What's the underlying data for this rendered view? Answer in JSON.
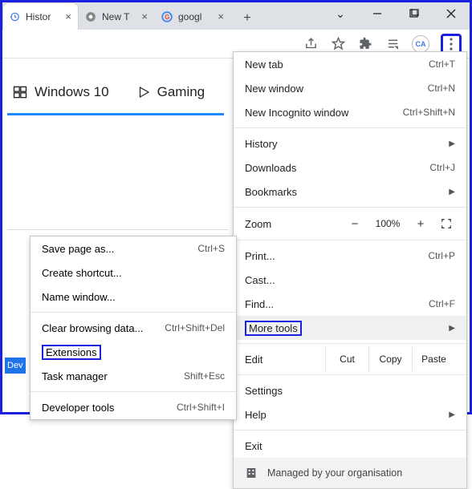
{
  "tabs": [
    {
      "label": "Histor",
      "icon": "history"
    },
    {
      "label": "New T",
      "icon": "chrome"
    },
    {
      "label": "googl",
      "icon": "google"
    }
  ],
  "winControls": {
    "dropdown": "⌄",
    "min": "—",
    "max": "▢",
    "close": "✕"
  },
  "toolbar": {
    "avatar": "CA"
  },
  "page": {
    "pill1": "Windows 10",
    "pill2": "Gaming"
  },
  "menu": {
    "newtab": {
      "label": "New tab",
      "accel": "Ctrl+T"
    },
    "newwin": {
      "label": "New window",
      "accel": "Ctrl+N"
    },
    "incog": {
      "label": "New Incognito window",
      "accel": "Ctrl+Shift+N"
    },
    "history": {
      "label": "History"
    },
    "downloads": {
      "label": "Downloads",
      "accel": "Ctrl+J"
    },
    "bookmarks": {
      "label": "Bookmarks"
    },
    "zoom": {
      "label": "Zoom",
      "value": "100%"
    },
    "print": {
      "label": "Print...",
      "accel": "Ctrl+P"
    },
    "cast": {
      "label": "Cast..."
    },
    "find": {
      "label": "Find...",
      "accel": "Ctrl+F"
    },
    "moretools": {
      "label": "More tools"
    },
    "edit": {
      "label": "Edit",
      "cut": "Cut",
      "copy": "Copy",
      "paste": "Paste"
    },
    "settings": {
      "label": "Settings"
    },
    "help": {
      "label": "Help"
    },
    "exit": {
      "label": "Exit"
    },
    "managed": {
      "label": "Managed by your organisation"
    }
  },
  "submenu": {
    "savepage": {
      "label": "Save page as...",
      "accel": "Ctrl+S"
    },
    "shortcut": {
      "label": "Create shortcut..."
    },
    "namewin": {
      "label": "Name window..."
    },
    "clear": {
      "label": "Clear browsing data...",
      "accel": "Ctrl+Shift+Del"
    },
    "ext": {
      "label": "Extensions"
    },
    "task": {
      "label": "Task manager",
      "accel": "Shift+Esc"
    },
    "devtools": {
      "label": "Developer tools",
      "accel": "Ctrl+Shift+I"
    }
  },
  "devbadge": "Dev"
}
